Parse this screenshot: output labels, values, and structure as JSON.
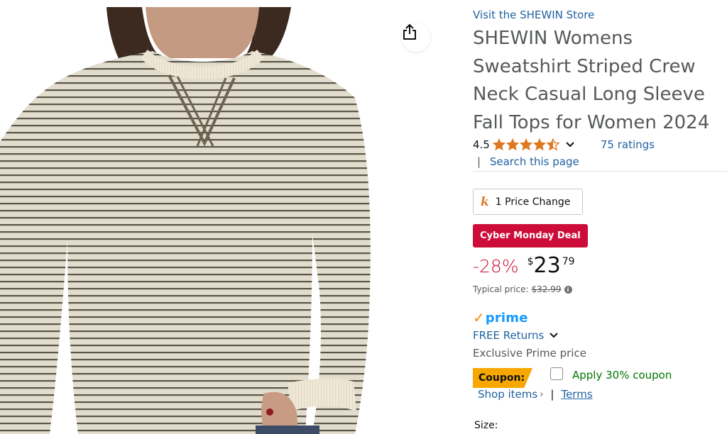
{
  "product": {
    "share_icon": "share-icon",
    "store_link": "Visit the SHEWIN Store",
    "title": "SHEWIN Womens Sweatshirt Striped Crew Neck Casual Long Sleeve Fall Tops for Women 2024",
    "rating_value": "4.5",
    "rating_out_of": 5,
    "ratings_count": "75 ratings",
    "search_separator": "|",
    "search_link": "Search this page",
    "price_change_icon": "keepa-icon",
    "price_change_label": "1 Price Change",
    "deal_badge": "Cyber Monday Deal",
    "discount": "-28%",
    "price_symbol": "$",
    "price_whole": "23",
    "price_fraction": "79",
    "typical_label": "Typical price:",
    "typical_price": "$32.99",
    "prime_check": "✓",
    "prime_label": "prime",
    "free_returns": "FREE Returns",
    "exclusive_text": "Exclusive Prime price",
    "coupon_label": "Coupon:",
    "coupon_apply": "Apply 30% coupon",
    "shop_items": "Shop items",
    "shop_caret": "›",
    "shop_separator": "|",
    "terms": "Terms",
    "size_label": "Size:"
  },
  "colors": {
    "link": "#2162a1",
    "deal_red": "#cc0c39",
    "prime_blue": "#1399ff",
    "prime_orange": "#f08804",
    "coupon_orange": "#f7a700",
    "coupon_green": "#007600",
    "star": "#de7921"
  }
}
